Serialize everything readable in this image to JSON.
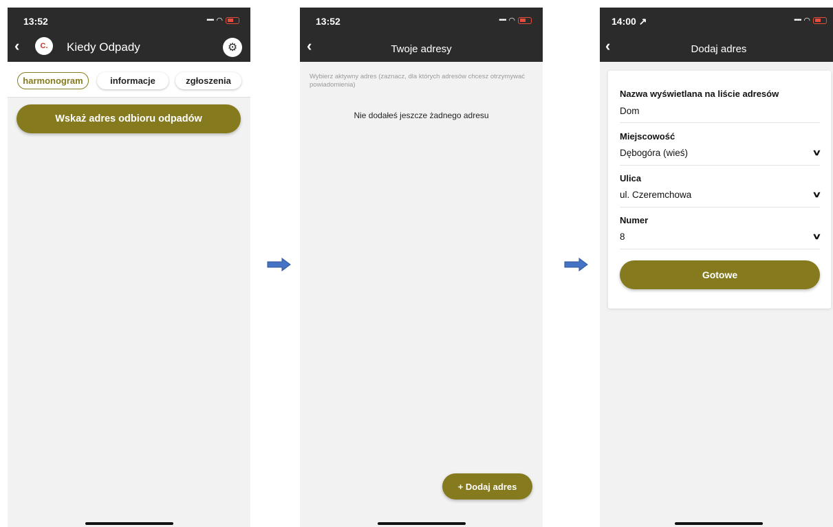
{
  "screen1": {
    "time": "13:52",
    "app_name": "Kiedy Odpady",
    "logo_letter": "C.",
    "tabs": [
      "harmonogram",
      "informacje",
      "zgłoszenia"
    ],
    "main_button": "Wskaż adres odbioru odpadów"
  },
  "screen2": {
    "time": "13:52",
    "title": "Twoje adresy",
    "hint": "Wybierz aktywny adres (zaznacz, dla których adresów chcesz otrzymywać powiadomienia)",
    "empty": "Nie dodałeś jeszcze żadnego adresu",
    "add_button": "+ Dodaj adres"
  },
  "screen3": {
    "time": "14:00 ↗",
    "title": "Dodaj adres",
    "fields": [
      {
        "label": "Nazwa wyświetlana na liście adresów",
        "value": "Dom"
      },
      {
        "label": "Miejscowość",
        "value": "Dębogóra (wieś)"
      },
      {
        "label": "Ulica",
        "value": "ul. Czeremchowa"
      },
      {
        "label": "Numer",
        "value": "8"
      }
    ],
    "done_button": "Gotowe"
  },
  "colors": {
    "accent": "#857a1e",
    "topbar": "#2b2b2b",
    "arrow": "#4472c4"
  },
  "icons": [
    "back-icon",
    "gear-icon",
    "chevron-down-icon",
    "wifi-icon",
    "battery-icon",
    "arrow-right-icon"
  ]
}
